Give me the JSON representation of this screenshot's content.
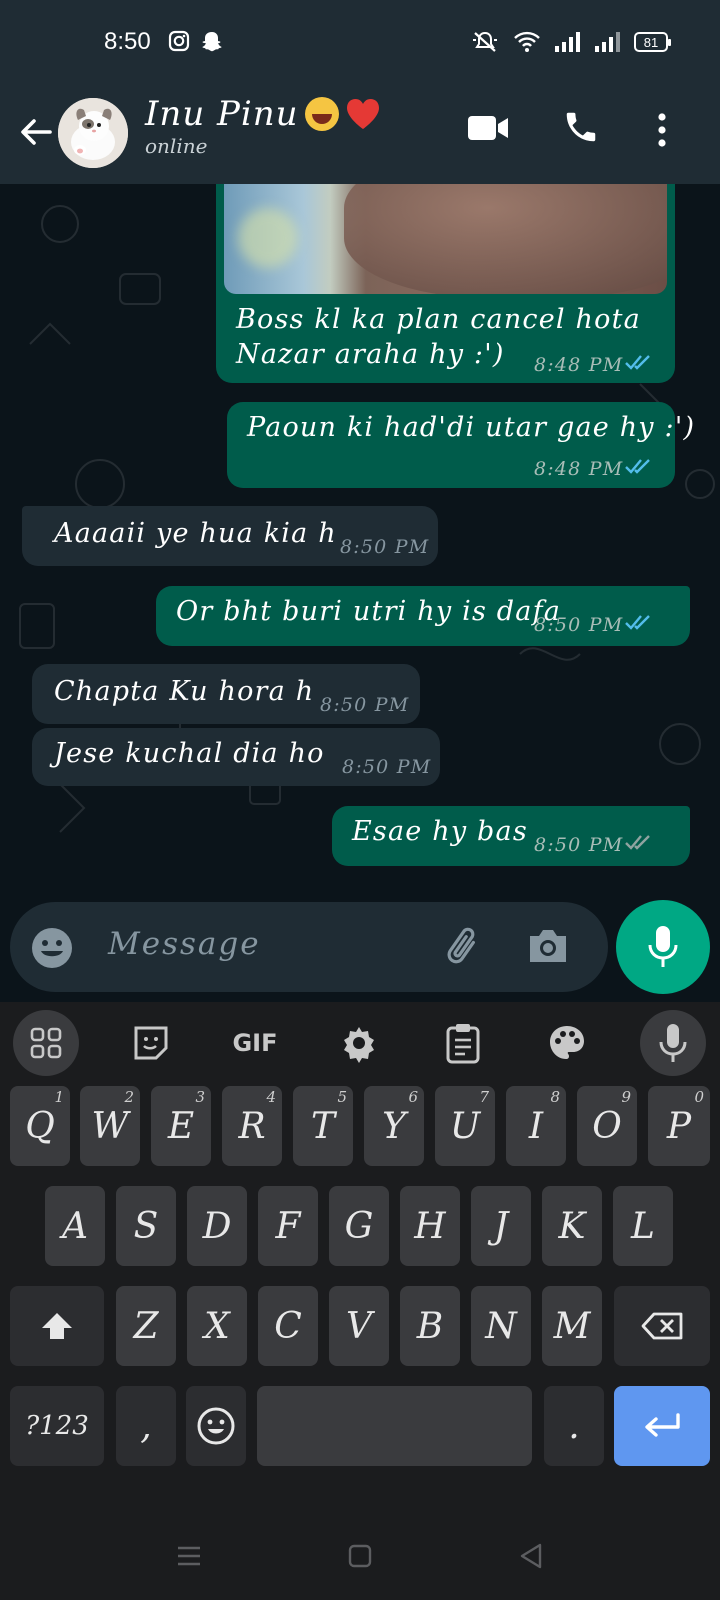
{
  "status_bar": {
    "time": "8:50",
    "battery": "81"
  },
  "header": {
    "contact_name": "Inu Pinu",
    "status": "online"
  },
  "messages": [
    {
      "dir": "out",
      "text_lines": [
        "Boss kl ka plan cancel hota",
        "Nazar araha hy :')"
      ],
      "time": "8:48 PM",
      "read": true,
      "has_image": true
    },
    {
      "dir": "out",
      "text_lines": [
        "Paoun ki had'di utar gae hy :')"
      ],
      "time": "8:48 PM",
      "read": true
    },
    {
      "dir": "in",
      "text_lines": [
        "Aaaaii ye hua kia h"
      ],
      "time": "8:50 PM"
    },
    {
      "dir": "out",
      "text_lines": [
        "Or bht buri utri hy is dafa"
      ],
      "time": "8:50 PM",
      "read": true
    },
    {
      "dir": "in",
      "text_lines": [
        "Chapta Ku hora h"
      ],
      "time": "8:50 PM"
    },
    {
      "dir": "in",
      "text_lines": [
        "Jese kuchal dia ho"
      ],
      "time": "8:50 PM"
    },
    {
      "dir": "out",
      "text_lines": [
        "Esae hy bas"
      ],
      "time": "8:50 PM",
      "read": false
    }
  ],
  "input": {
    "placeholder": "Message"
  },
  "keyboard": {
    "toolbar": [
      "apps-icon",
      "sticker-icon",
      "GIF",
      "settings-icon",
      "clipboard-icon",
      "palette-icon",
      "mic-icon"
    ],
    "row1": [
      {
        "k": "Q",
        "h": "1"
      },
      {
        "k": "W",
        "h": "2"
      },
      {
        "k": "E",
        "h": "3"
      },
      {
        "k": "R",
        "h": "4"
      },
      {
        "k": "T",
        "h": "5"
      },
      {
        "k": "Y",
        "h": "6"
      },
      {
        "k": "U",
        "h": "7"
      },
      {
        "k": "I",
        "h": "8"
      },
      {
        "k": "O",
        "h": "9"
      },
      {
        "k": "P",
        "h": "0"
      }
    ],
    "row2": [
      "A",
      "S",
      "D",
      "F",
      "G",
      "H",
      "J",
      "K",
      "L"
    ],
    "row3": [
      "Z",
      "X",
      "C",
      "V",
      "B",
      "N",
      "M"
    ],
    "symbols_label": "?123",
    "comma": ",",
    "period": "."
  },
  "colors": {
    "outgoing": "#005c4b",
    "incoming": "#1f2c34",
    "header": "#1f2c34",
    "accent": "#00a884",
    "read_ticks": "#53bdeb",
    "enter_key": "#5f97f0"
  }
}
